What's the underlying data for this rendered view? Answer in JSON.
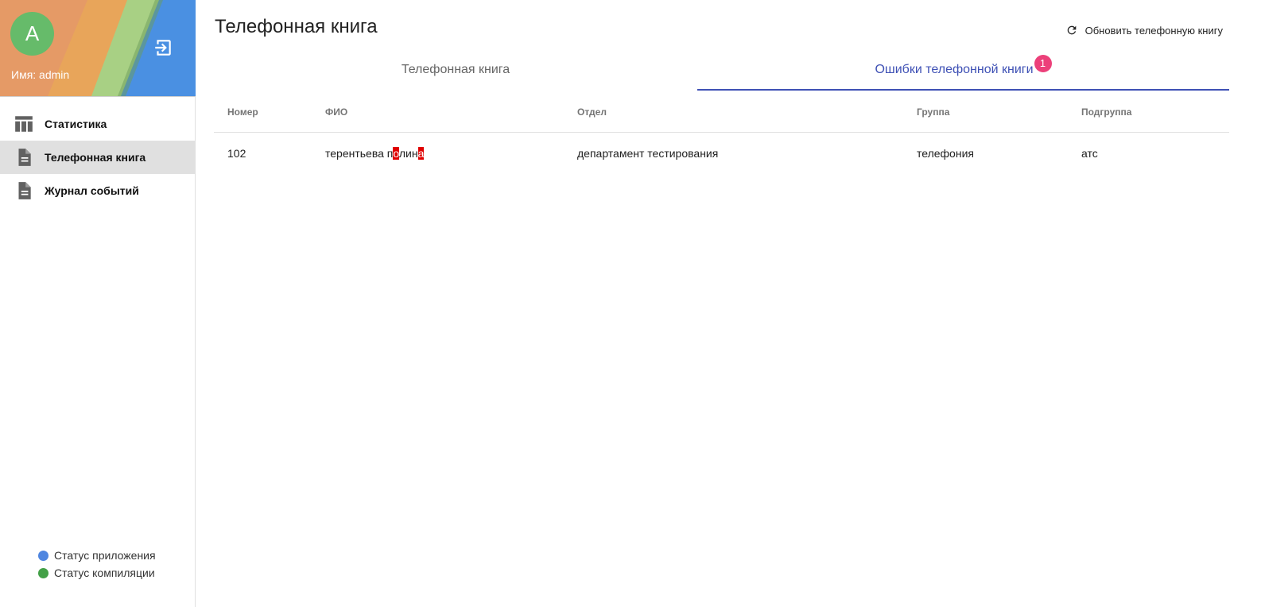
{
  "sidebar": {
    "avatar_letter": "A",
    "user_label": "Имя: admin",
    "nav": [
      {
        "label": "Статистика",
        "icon": "table-icon",
        "active": false
      },
      {
        "label": "Телефонная книга",
        "icon": "document-icon",
        "active": true
      },
      {
        "label": "Журнал событий",
        "icon": "document-icon",
        "active": false
      }
    ],
    "status": [
      {
        "label": "Статус приложения",
        "color": "#4f86e0"
      },
      {
        "label": "Статус компиляции",
        "color": "#43a047"
      }
    ]
  },
  "header": {
    "title": "Телефонная книга",
    "refresh_label": "Обновить телефонную книгу"
  },
  "tabs": [
    {
      "label": "Телефонная книга",
      "active": false
    },
    {
      "label": "Ошибки телефонной книги",
      "active": true,
      "badge": "1"
    }
  ],
  "table": {
    "columns": [
      "Номер",
      "ФИО",
      "Отдел",
      "Группа",
      "Подгруппа"
    ],
    "rows": [
      {
        "number": "102",
        "fio_parts": [
          "терентьева п",
          "о",
          "лин",
          "а"
        ],
        "department": "департамент тестирования",
        "group": "телефония",
        "subgroup": "атс"
      }
    ]
  },
  "colors": {
    "accent": "#3f51b5",
    "badge": "#ec407a",
    "avatar": "#66bb6a",
    "error_highlight": "#e00000"
  }
}
